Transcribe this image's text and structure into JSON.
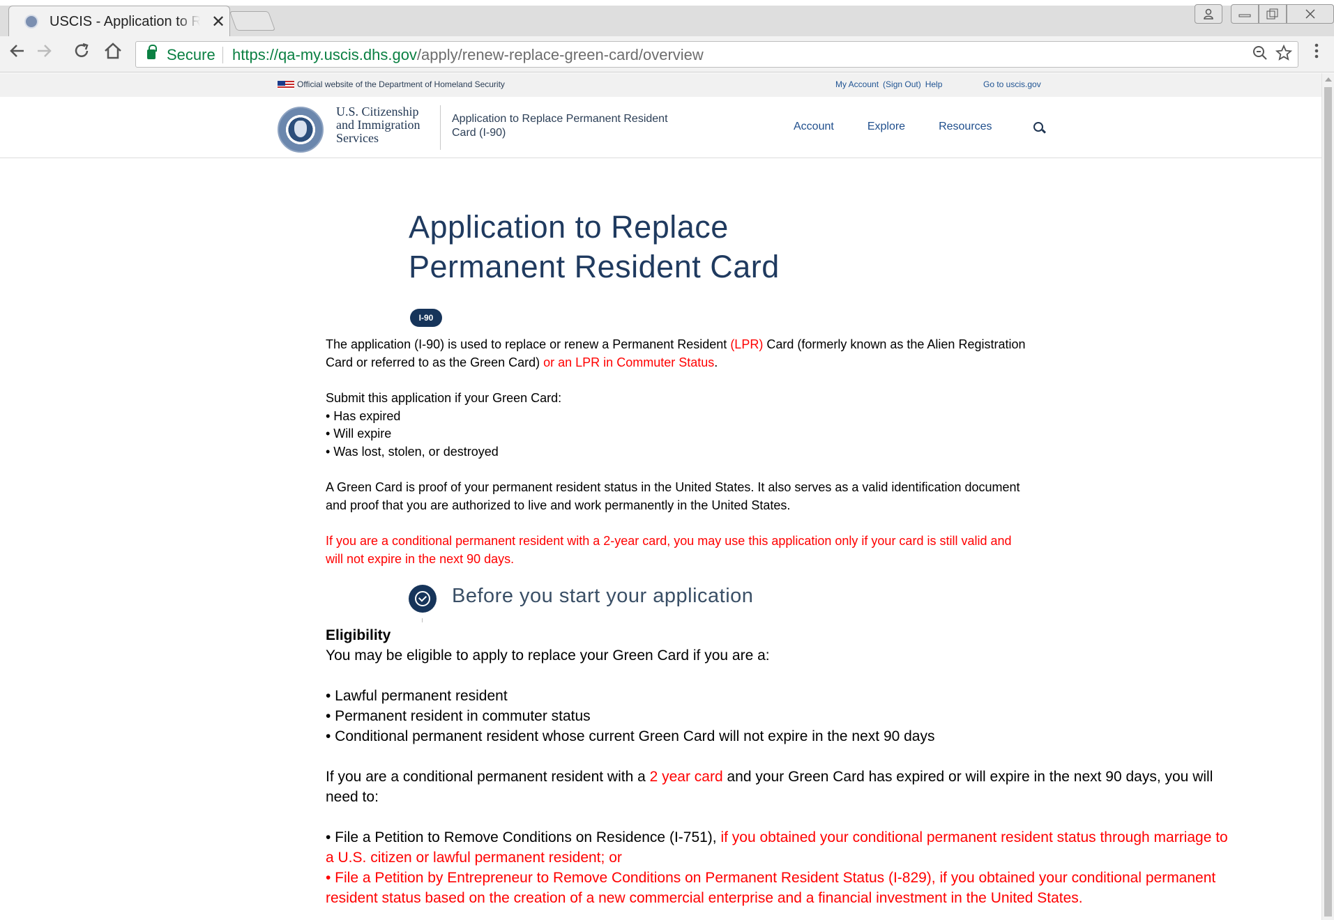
{
  "browser": {
    "tab_title": "USCIS - Application to Replace",
    "tab_close": "✕",
    "secure_label": "Secure",
    "url_main": "https://qa-my.uscis.dhs.gov",
    "url_path": "/apply/renew-replace-green-card/overview",
    "icons": [
      "back-arrow-icon",
      "forward-arrow-icon",
      "reload-icon",
      "home-icon",
      "zoom-icon",
      "star-icon",
      "menu-icon"
    ]
  },
  "banner": {
    "official": "Official website of the Department of Homeland Security",
    "my_account": "My Account",
    "sign_out": "(Sign Out)",
    "help": "Help",
    "goto": "Go to uscis.gov"
  },
  "header": {
    "agency_line1": "U.S. Citizenship",
    "agency_line2": "and Immigration",
    "agency_line3": "Services",
    "app_title": "Application to Replace Permanent Resident Card (I-90)",
    "nav": {
      "account": "Account",
      "explore": "Explore",
      "resources": "Resources"
    }
  },
  "main": {
    "title_line1": "Application to Replace",
    "title_line2": "Permanent Resident Card",
    "badge": "I-90",
    "intro_a": "The application (I-90) is used to replace or renew a Permanent Resident ",
    "intro_lpr": "(LPR)",
    "intro_b": " Card (formerly known as the Alien Registration",
    "intro_c": "Card or referred to as the Green Card) ",
    "intro_commuter": "or an LPR in Commuter Status",
    "intro_end": ".",
    "submit_heading": "Submit this application if your Green Card:",
    "submit_items": [
      "• Has expired",
      "• Will expire",
      "• Was lost, stolen, or destroyed"
    ],
    "proof_line1": "A Green Card is proof of your permanent resident status in the United States. It also serves as a valid identification document",
    "proof_line2": "and proof that you are authorized to live and work permanently in the United States.",
    "conditional_line1": "If you are a conditional permanent resident with a 2-year card, you may use this application only if your card is still valid and",
    "conditional_line2": "will not expire in the next 90 days.",
    "before_title": "Before you start your application"
  },
  "eligibility": {
    "heading": "Eligibility",
    "intro": "You may be eligible to apply to replace your Green Card if you are a:",
    "items": [
      "• Lawful permanent resident",
      "• Permanent resident in commuter status",
      "• Conditional permanent resident whose current Green Card will not expire in the next 90 days"
    ],
    "cond_a": "If you are a conditional permanent resident with a ",
    "cond_red": "2 year card",
    "cond_b": " and your Green Card has expired or will expire in the next 90 days, you will",
    "cond_c": "need to:",
    "file1_a": "• File a Petition to Remove Conditions on Residence (I-751), ",
    "file1_red": "if you obtained your conditional permanent resident status through marriage to",
    "file1_red2": "a U.S. citizen or lawful permanent resident; or",
    "file2_line1": "• File a Petition by Entrepreneur to Remove Conditions on Permanent Resident Status (I-829), if you obtained your conditional permanent",
    "file2_line2": "resident status based on the creation of a new commercial enterprise and a financial investment in the United States."
  },
  "colors": {
    "accent_red": "#ff0000",
    "navy": "#16345a",
    "link_blue": "#1f4e8c",
    "secure_green": "#0b8043"
  }
}
